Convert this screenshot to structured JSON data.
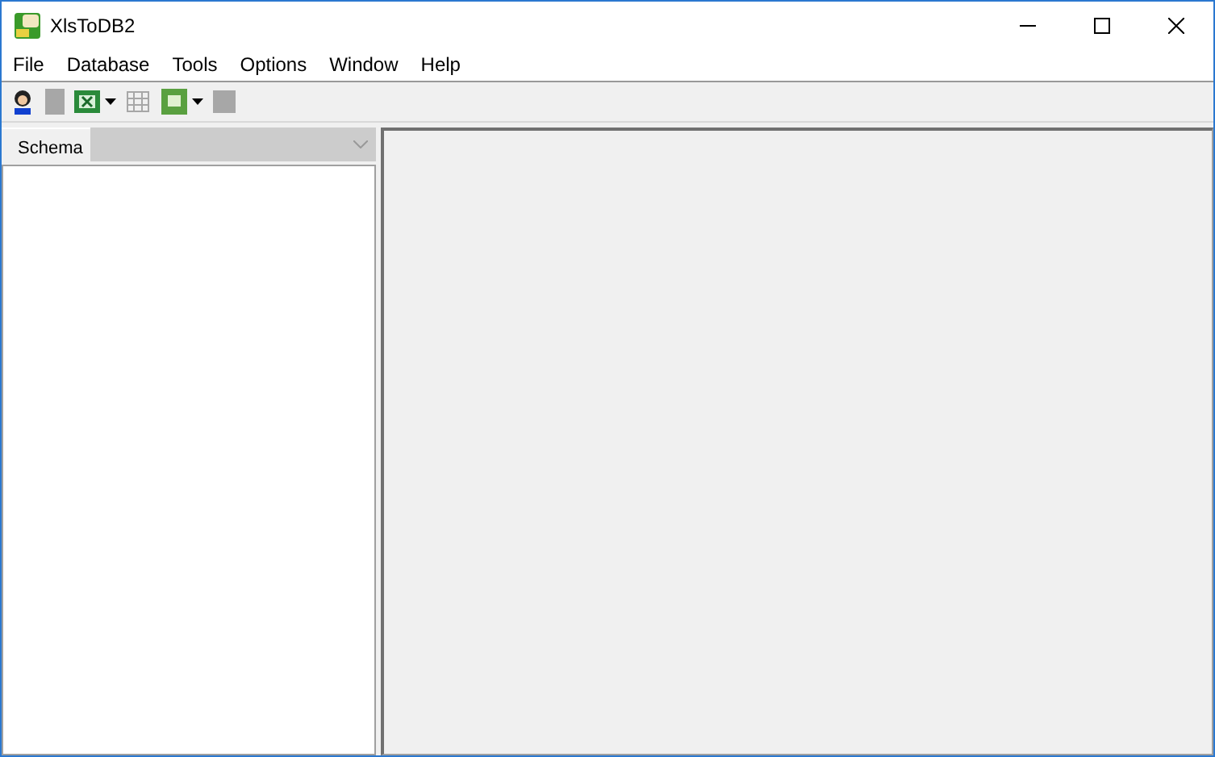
{
  "window": {
    "title": "XlsToDB2"
  },
  "menu": [
    "File",
    "Database",
    "Tools",
    "Options",
    "Window",
    "Help"
  ],
  "toolbar": [
    {
      "disabled": false,
      "dropdown": false
    },
    {
      "disabled": true,
      "dropdown": false
    },
    {
      "disabled": false,
      "dropdown": true
    },
    {
      "disabled": true,
      "dropdown": false
    },
    {
      "disabled": false,
      "dropdown": true
    },
    {
      "disabled": true,
      "dropdown": false
    }
  ],
  "schema": {
    "label": "Schema",
    "disabled": true
  }
}
